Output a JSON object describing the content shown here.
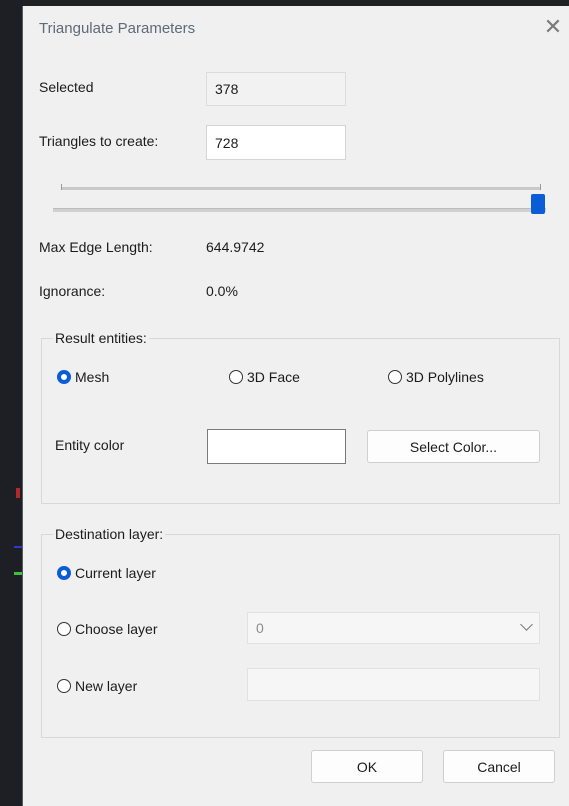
{
  "dialog": {
    "title": "Triangulate Parameters",
    "close_glyph": "✕"
  },
  "selected": {
    "label": "Selected",
    "value": "378"
  },
  "triangles": {
    "label": "Triangles to create:",
    "value": "728"
  },
  "slider": {
    "fraction": 1.0
  },
  "stats": {
    "max_edge_label": "Max Edge Length:",
    "max_edge_value": "644.9742",
    "ignorance_label": "Ignorance:",
    "ignorance_value": "0.0%"
  },
  "result": {
    "title": "Result entities:",
    "options": [
      {
        "label": "Mesh",
        "checked": true
      },
      {
        "label": "3D Face",
        "checked": false
      },
      {
        "label": "3D Polylines",
        "checked": false
      }
    ],
    "entity_color_label": "Entity color",
    "entity_color_value": "",
    "select_color_label": "Select Color..."
  },
  "destination": {
    "title": "Destination layer:",
    "current_label": "Current layer",
    "current_checked": true,
    "choose_label": "Choose layer",
    "choose_checked": false,
    "choose_value": "0",
    "new_label": "New layer",
    "new_checked": false,
    "new_value": ""
  },
  "buttons": {
    "ok": "OK",
    "cancel": "Cancel"
  },
  "colors": {
    "accent": "#0b5cd7",
    "dialog_bg": "#f0f0f0"
  }
}
